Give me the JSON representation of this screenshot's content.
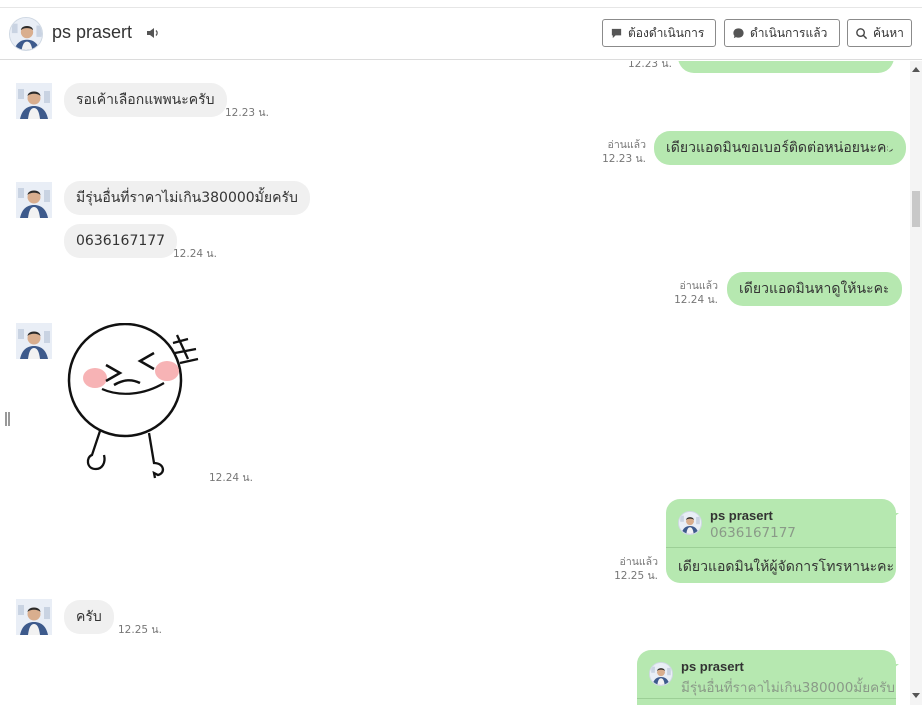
{
  "header": {
    "contact_name": "ps prasert",
    "buttons": {
      "pending": "ต้องดำเนินการ",
      "done": "ดำเนินการแล้ว",
      "search": "ค้นหา"
    }
  },
  "messages": {
    "top_cut_time": "12.23 น.",
    "m1": {
      "text": "รอเค้าเลือกแพพนะครับ",
      "time": "12.23 น."
    },
    "m2": {
      "text": "เดียวแอดมินขอเบอร์ติดต่อหน่อยนะคะ",
      "read": "อ่านแล้ว",
      "time": "12.23 น."
    },
    "m3": {
      "text": "มีรุ่นอื่นที่ราคาไม่เกิน380000มั้ยครับ"
    },
    "m4": {
      "text": "0636167177",
      "time": "12.24 น."
    },
    "m5": {
      "text": "เดียวแอดมินหาดูให้นะคะ",
      "read": "อ่านแล้ว",
      "time": "12.24 น."
    },
    "m6": {
      "time": "12.24 น."
    },
    "m7": {
      "reply_name": "ps prasert",
      "reply_quote": "0636167177",
      "text": "เดียวแอดมินให้ผู้จัดการโทรหานะคะ",
      "read": "อ่านแล้ว",
      "time": "12.25 น."
    },
    "m8": {
      "text": "ครับ",
      "time": "12.25 น."
    },
    "m9": {
      "reply_name": "ps prasert",
      "reply_quote": "มีรุ่นอื่นที่ราคาไม่เกิน380000มั้ยครับ"
    }
  },
  "colors": {
    "outgoing_bubble": "#b6e8b0",
    "incoming_bubble": "#f0f0f0"
  }
}
